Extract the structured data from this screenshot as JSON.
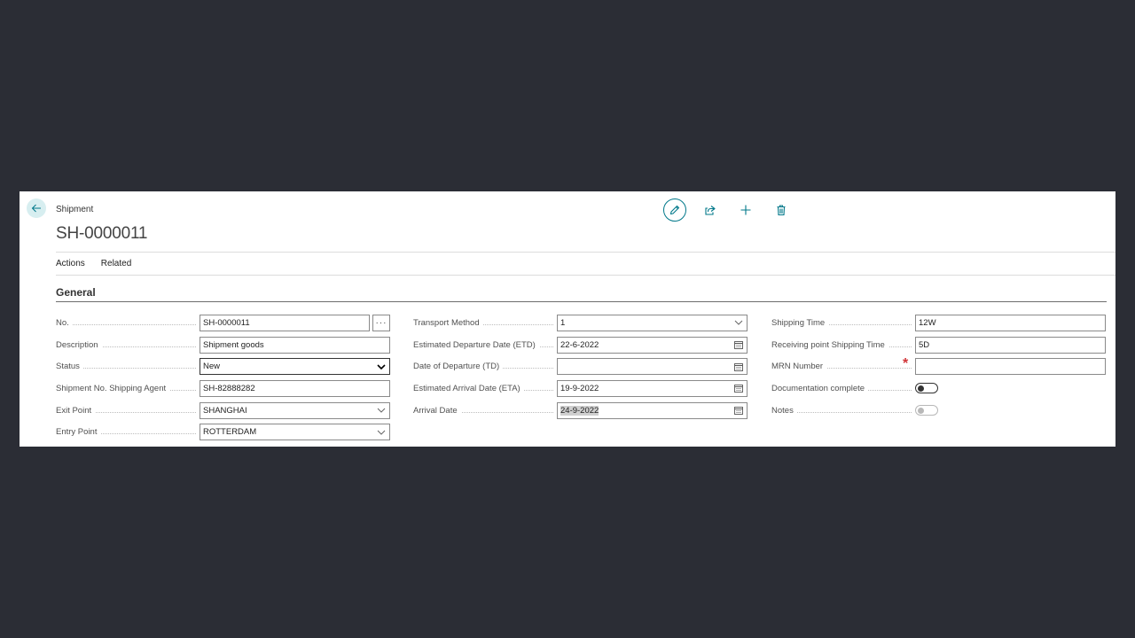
{
  "header": {
    "caption": "Shipment",
    "title": "SH-0000011"
  },
  "toolbar": {
    "edit_icon": "pencil-icon",
    "share_icon": "share-icon",
    "new_icon": "plus-icon",
    "delete_icon": "trash-icon"
  },
  "menu": {
    "actions": "Actions",
    "related": "Related"
  },
  "section": {
    "title": "General"
  },
  "fields": {
    "no": {
      "label": "No.",
      "value": "SH-0000011",
      "assist": "···"
    },
    "description": {
      "label": "Description",
      "value": "Shipment goods"
    },
    "status": {
      "label": "Status",
      "value": "New"
    },
    "shipment_no_agent": {
      "label": "Shipment No. Shipping Agent",
      "value": "SH-82888282"
    },
    "exit_point": {
      "label": "Exit Point",
      "value": "SHANGHAI"
    },
    "entry_point": {
      "label": "Entry Point",
      "value": "ROTTERDAM"
    },
    "transport_method": {
      "label": "Transport Method",
      "value": "1"
    },
    "etd": {
      "label": "Estimated Departure Date (ETD)",
      "value": "22-6-2022"
    },
    "td": {
      "label": "Date of Departure (TD)",
      "value": ""
    },
    "eta": {
      "label": "Estimated Arrival Date (ETA)",
      "value": "19-9-2022"
    },
    "arrival_date": {
      "label": "Arrival Date",
      "value": "24-9-2022"
    },
    "shipping_time": {
      "label": "Shipping Time",
      "value": "12W"
    },
    "receiving_shipping_time": {
      "label": "Receiving point Shipping Time",
      "value": "5D"
    },
    "mrn_number": {
      "label": "MRN Number",
      "value": "",
      "required_mark": "*"
    },
    "documentation_complete": {
      "label": "Documentation complete",
      "value": false
    },
    "notes": {
      "label": "Notes",
      "value": false
    }
  },
  "colors": {
    "accent": "#00788a",
    "background": "#2b2d35",
    "required": "#d13438"
  }
}
